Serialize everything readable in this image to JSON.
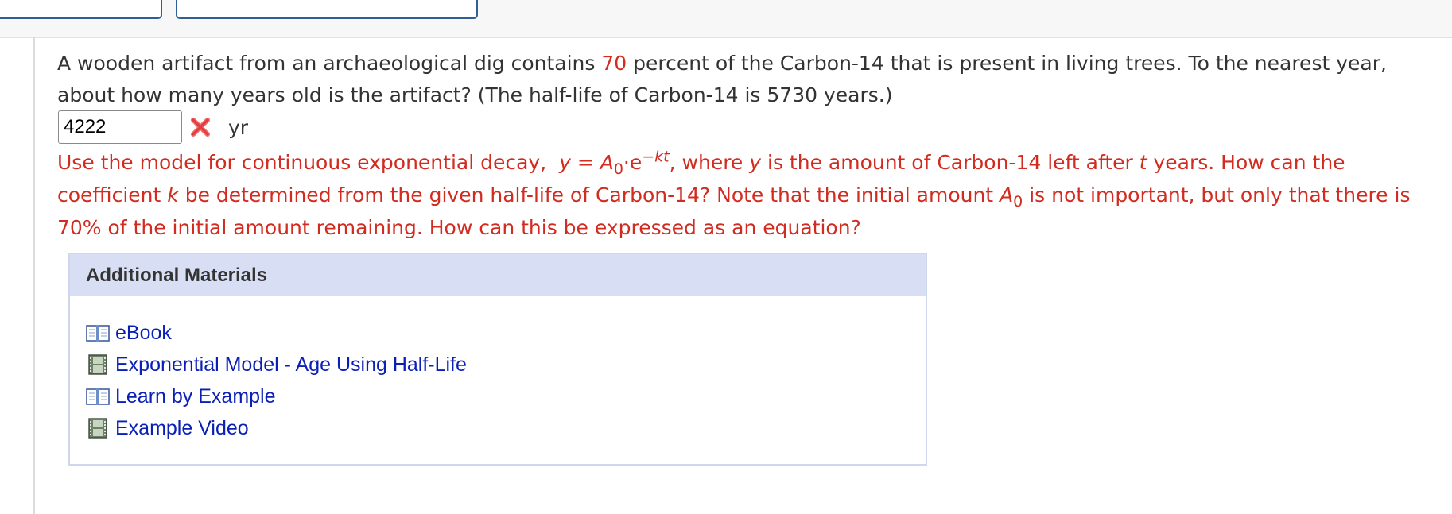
{
  "question": {
    "text_before": "A wooden artifact from an archaeological dig contains ",
    "percent": "70",
    "text_after": " percent of the Carbon-14 that is present in living trees. To the nearest year, about how many years old is the artifact? (The half-life of Carbon-14 is 5730 years.)"
  },
  "answer": {
    "value": "4222",
    "unit": "yr",
    "status_icon": "x-icon",
    "status": "incorrect"
  },
  "hint": {
    "p1": "Use the model for continuous exponential decay,",
    "eq_y": "y",
    "eq_eq": " = ",
    "eq_A": "A",
    "eq_sub0": "0",
    "eq_dot_e": "·e",
    "eq_exp": "−kt",
    "eq_comma": ",",
    "p2": " where ",
    "v_y": "y",
    "p3": " is the amount of Carbon-14 left after ",
    "v_t": "t",
    "p4": " years. How can the coefficient ",
    "v_k": "k",
    "p5": " be determined from the given half-life of Carbon-14? Note that the initial amount ",
    "v_A": "A",
    "v_sub0": "0",
    "p6": " is not important, but only that there is 70% of the initial amount remaining. How can this be expressed as an equation?"
  },
  "materials": {
    "title": "Additional Materials",
    "items": [
      {
        "label": "eBook",
        "icon": "book-icon"
      },
      {
        "label": "Exponential Model - Age Using Half-Life",
        "icon": "film-icon"
      },
      {
        "label": "Learn by Example",
        "icon": "book-icon"
      },
      {
        "label": "Example Video",
        "icon": "film-icon"
      }
    ]
  },
  "colors": {
    "hint_red": "#d22b20",
    "link_blue": "#0a1fb5",
    "panel_header": "#d8def4",
    "panel_border": "#cfd8ea"
  }
}
